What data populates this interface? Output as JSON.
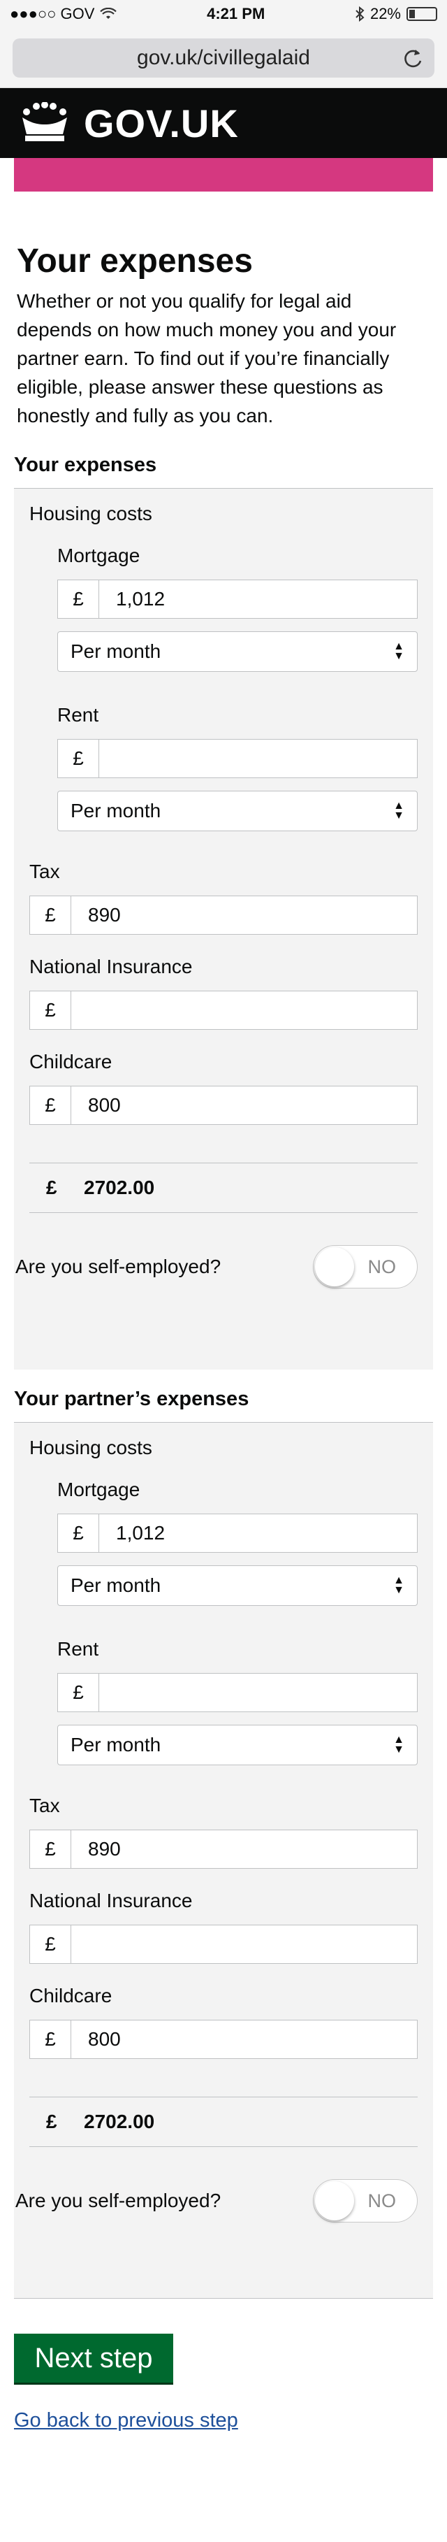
{
  "status_bar": {
    "carrier": "●●●○○ GOV",
    "time": "4:21 PM",
    "battery": "22%"
  },
  "browser": {
    "url": "gov.uk/civillegalaid"
  },
  "header": {
    "logo_text": "GOV.UK"
  },
  "page": {
    "title": "Your expenses",
    "intro": "Whether or not you qualify for legal aid depends on how much money you and your partner earn. To find out if you’re financially eligible, please answer these questions as honestly and fully as you can."
  },
  "sections": [
    {
      "heading": "Your expenses",
      "housing_label": "Housing costs",
      "mortgage_label": "Mortgage",
      "mortgage_value": "1,012",
      "mortgage_period": "Per month",
      "rent_label": "Rent",
      "rent_value": "",
      "rent_period": "Per month",
      "tax_label": "Tax",
      "tax_value": "890",
      "ni_label": "National Insurance",
      "ni_value": "",
      "childcare_label": "Childcare",
      "childcare_value": "800",
      "currency": "£",
      "total": "2702.00",
      "self_employed_label": "Are you self-employed?",
      "self_employed_state": "NO"
    },
    {
      "heading": "Your partner’s expenses",
      "housing_label": "Housing costs",
      "mortgage_label": "Mortgage",
      "mortgage_value": "1,012",
      "mortgage_period": "Per month",
      "rent_label": "Rent",
      "rent_value": "",
      "rent_period": "Per month",
      "tax_label": "Tax",
      "tax_value": "890",
      "ni_label": "National Insurance",
      "ni_value": "",
      "childcare_label": "Childcare",
      "childcare_value": "800",
      "currency": "£",
      "total": "2702.00",
      "self_employed_label": "Are you self-employed?",
      "self_employed_state": "NO"
    }
  ],
  "actions": {
    "next": "Next step",
    "back": "Go back to previous step"
  },
  "colors": {
    "header_bg": "#0b0c0c",
    "accent_bar": "#d53880",
    "button": "#00692f",
    "link": "#1d4f9a",
    "panel": "#f3f3f3"
  }
}
